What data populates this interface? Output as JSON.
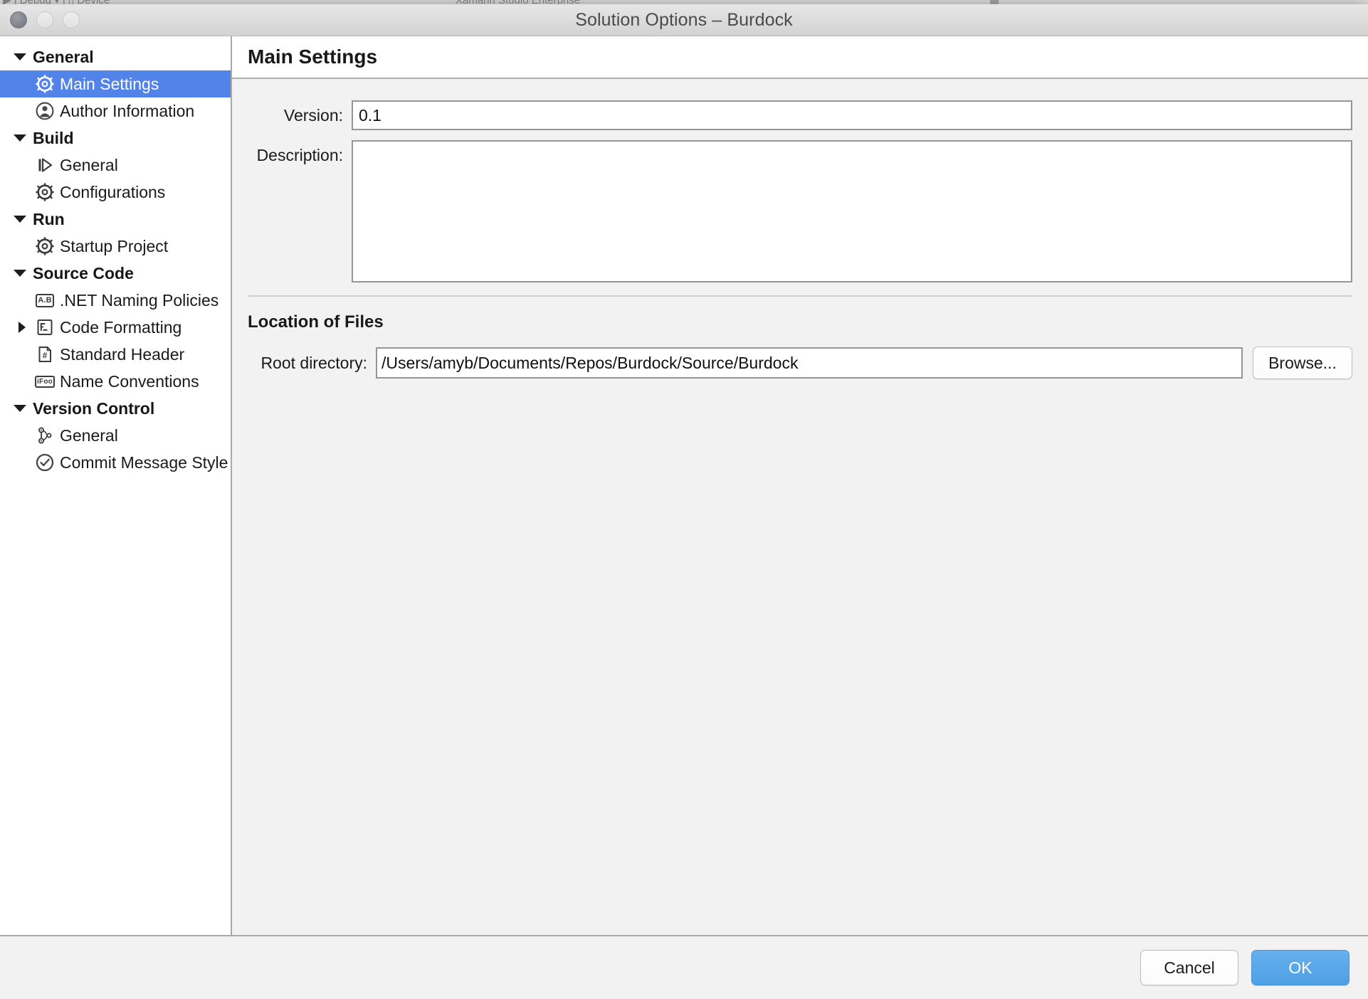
{
  "background_app": {
    "toolbar_left": "▶ | Debug ▾ | ▯ Device",
    "toolbar_center": "Xamarin Studio Enterprise",
    "toolbar_right": "▦"
  },
  "window": {
    "title": "Solution Options – Burdock",
    "traffic_lights": [
      {
        "name": "close-button",
        "state": "active"
      },
      {
        "name": "minimize-button",
        "state": "disabled"
      },
      {
        "name": "zoom-button",
        "state": "disabled"
      }
    ]
  },
  "sidebar": {
    "groups": [
      {
        "label": "General",
        "expanded": true,
        "items": [
          {
            "label": "Main Settings",
            "icon": "gear-icon",
            "selected": true,
            "has_disclosure": false
          },
          {
            "label": "Author Information",
            "icon": "person-icon",
            "selected": false,
            "has_disclosure": false
          }
        ]
      },
      {
        "label": "Build",
        "expanded": true,
        "items": [
          {
            "label": "General",
            "icon": "build-play-icon",
            "selected": false,
            "has_disclosure": false
          },
          {
            "label": "Configurations",
            "icon": "gear-icon",
            "selected": false,
            "has_disclosure": false
          }
        ]
      },
      {
        "label": "Run",
        "expanded": true,
        "items": [
          {
            "label": "Startup Project",
            "icon": "gear-icon",
            "selected": false,
            "has_disclosure": false
          }
        ]
      },
      {
        "label": "Source Code",
        "expanded": true,
        "items": [
          {
            "label": ".NET Naming Policies",
            "icon": "ab-box-icon",
            "icon_text": "A.B",
            "selected": false,
            "has_disclosure": false
          },
          {
            "label": "Code Formatting",
            "icon": "code-formatting-icon",
            "selected": false,
            "has_disclosure": true,
            "disclosure_state": "collapsed"
          },
          {
            "label": "Standard Header",
            "icon": "hash-document-icon",
            "icon_text": "#",
            "selected": false,
            "has_disclosure": false
          },
          {
            "label": "Name Conventions",
            "icon": "ifoo-box-icon",
            "icon_text": "iFoo",
            "selected": false,
            "has_disclosure": false
          }
        ]
      },
      {
        "label": "Version Control",
        "expanded": true,
        "items": [
          {
            "label": "General",
            "icon": "git-branch-icon",
            "selected": false,
            "has_disclosure": false
          },
          {
            "label": "Commit Message Style",
            "icon": "check-circle-icon",
            "selected": false,
            "has_disclosure": false
          }
        ]
      }
    ]
  },
  "main": {
    "title": "Main Settings",
    "fields": {
      "version_label": "Version:",
      "version_value": "0.1",
      "description_label": "Description:",
      "description_value": ""
    },
    "location_section": {
      "title": "Location of Files",
      "root_directory_label": "Root directory:",
      "root_directory_value": "/Users/amyb/Documents/Repos/Burdock/Source/Burdock",
      "browse_label": "Browse..."
    }
  },
  "footer": {
    "cancel_label": "Cancel",
    "ok_label": "OK"
  },
  "colors": {
    "selection_blue": "#5183e8",
    "ok_button_blue": "#55a8e8",
    "sidebar_background": "#ffffff",
    "content_background": "#f2f2f2",
    "border_gray": "#959595"
  }
}
